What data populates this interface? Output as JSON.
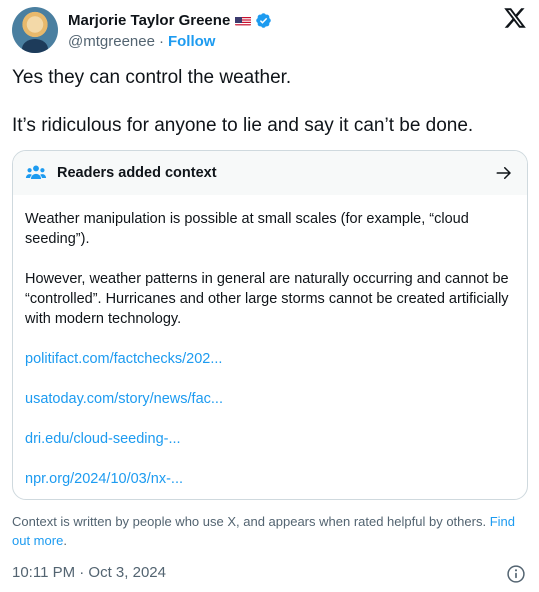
{
  "author": {
    "display_name": "Marjorie Taylor Greene",
    "handle": "@mtgreenee",
    "separator": "·",
    "follow_label": "Follow",
    "flag_icon": "us-flag-icon",
    "verified_icon": "verified-badge-icon",
    "verified_color": "#1d9bf0"
  },
  "brand": {
    "logo_icon": "x-logo-icon"
  },
  "tweet": {
    "line1": "Yes they can control the weather.",
    "line2": "It’s ridiculous for anyone to lie and say it can’t be done."
  },
  "community_note": {
    "title": "Readers added context",
    "paragraph1": "Weather manipulation is possible at small scales (for example, “cloud seeding”).",
    "paragraph2": "However, weather patterns in general are naturally occurring and cannot be “controlled”. Hurricanes and other large storms cannot be created artificially with modern technology.",
    "links": [
      "politifact.com/factchecks/202...",
      "usatoday.com/story/news/fac...",
      "dri.edu/cloud-seeding-...",
      "npr.org/2024/10/03/nx-..."
    ],
    "footer_text": "Context is written by people who use X, and appears when rated helpful by others.",
    "find_out_more": "Find out more",
    "footer_period": "."
  },
  "meta": {
    "timestamp": "10:11 PM · Oct 3, 2024"
  },
  "colors": {
    "accent": "#1d9bf0",
    "text": "#0f1419",
    "muted": "#536471",
    "border": "#cfd9de",
    "note_header_bg": "#f7f9f9"
  }
}
